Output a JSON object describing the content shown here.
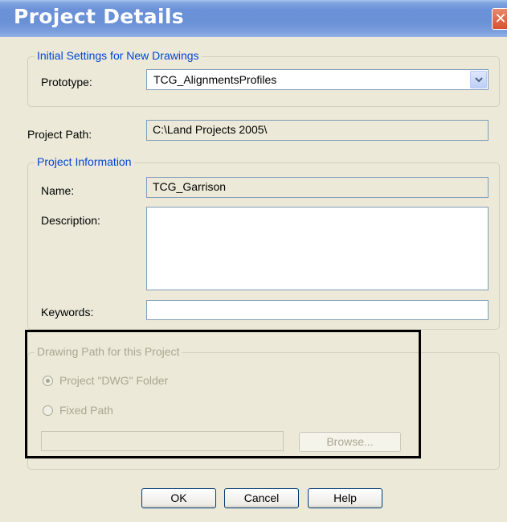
{
  "window": {
    "title": "Project Details",
    "close_glyph": "✕"
  },
  "initial_settings": {
    "legend": "Initial Settings for New Drawings",
    "prototype_label": "Prototype:",
    "prototype_value": "TCG_AlignmentsProfiles"
  },
  "project_path": {
    "label": "Project Path:",
    "value": "C:\\Land Projects 2005\\"
  },
  "project_information": {
    "legend": "Project Information",
    "name_label": "Name:",
    "name_value": "TCG_Garrison",
    "description_label": "Description:",
    "description_value": "",
    "keywords_label": "Keywords:",
    "keywords_value": ""
  },
  "drawing_path": {
    "legend": "Drawing Path for this Project",
    "option_dwg": "Project \"DWG\" Folder",
    "option_fixed": "Fixed Path",
    "selected": "Project \"DWG\" Folder",
    "path_value": "",
    "browse_label": "Browse..."
  },
  "buttons": {
    "ok": "OK",
    "cancel": "Cancel",
    "help": "Help"
  },
  "colors": {
    "title_bar": "#6a90d6",
    "dialog_bg": "#ECE9D8",
    "legend_blue": "#0046d5",
    "disabled_text": "#a9a792",
    "highlight_box": "#000000"
  }
}
